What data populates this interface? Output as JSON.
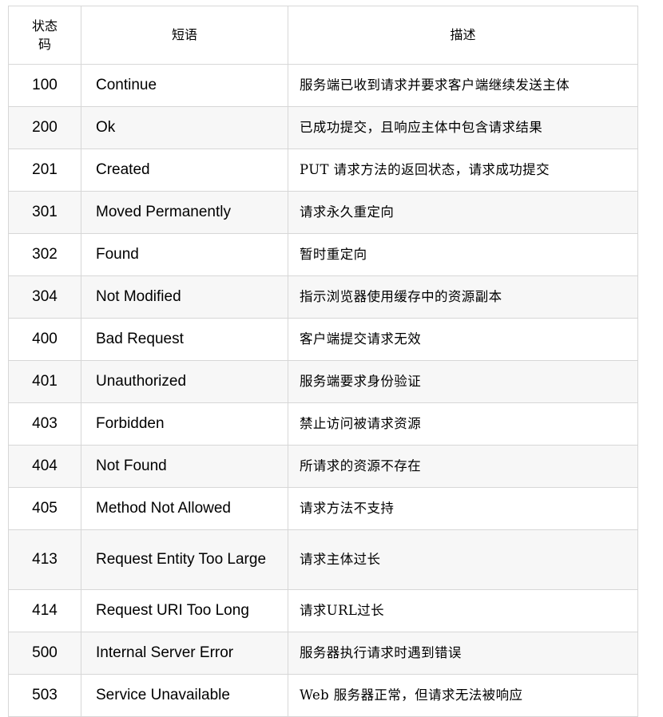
{
  "table": {
    "headers": {
      "code": "状态码",
      "phrase": "短语",
      "description": "描述"
    },
    "rows": [
      {
        "code": "100",
        "phrase": "Continue",
        "description": "服务端已收到请求并要求客户端继续发送主体"
      },
      {
        "code": "200",
        "phrase": "Ok",
        "description": "已成功提交，且响应主体中包含请求结果"
      },
      {
        "code": "201",
        "phrase": "Created",
        "description": "PUT 请求方法的返回状态，请求成功提交"
      },
      {
        "code": "301",
        "phrase": "Moved Permanently",
        "description": "请求永久重定向"
      },
      {
        "code": "302",
        "phrase": "Found",
        "description": "暂时重定向"
      },
      {
        "code": "304",
        "phrase": "Not Modified",
        "description": "指示浏览器使用缓存中的资源副本"
      },
      {
        "code": "400",
        "phrase": "Bad Request",
        "description": "客户端提交请求无效"
      },
      {
        "code": "401",
        "phrase": "Unauthorized",
        "description": "服务端要求身份验证"
      },
      {
        "code": "403",
        "phrase": "Forbidden",
        "description": "禁止访问被请求资源"
      },
      {
        "code": "404",
        "phrase": "Not Found",
        "description": "所请求的资源不存在"
      },
      {
        "code": "405",
        "phrase": "Method Not Allowed",
        "description": "请求方法不支持"
      },
      {
        "code": "413",
        "phrase": "Request Entity Too Large",
        "description": "请求主体过长"
      },
      {
        "code": "414",
        "phrase": "Request URI Too Long",
        "description": "请求URL过长"
      },
      {
        "code": "500",
        "phrase": "Internal Server Error",
        "description": "服务器执行请求时遇到错误"
      },
      {
        "code": "503",
        "phrase": "Service Unavailable",
        "description": "Web 服务器正常，但请求无法被响应"
      }
    ],
    "colors": {
      "border": "#d7d7d7",
      "row_odd_bg": "#ffffff",
      "row_even_bg": "#f7f7f7",
      "text": "#000000",
      "page_bg": "#ffffff"
    }
  }
}
